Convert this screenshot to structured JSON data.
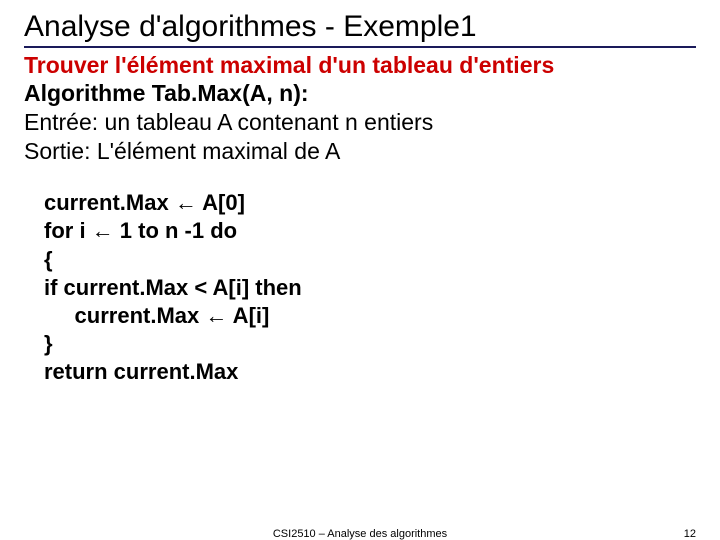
{
  "title": "Analyse d'algorithmes - Exemple1",
  "subtitle": "Trouver l'élément maximal d'un tableau d'entiers",
  "desc": {
    "algo_label": "Algorithme Tab.Max(A, n):",
    "input": "Entrée: un tableau A contenant n entiers",
    "output": "Sortie: L'élément maximal de A"
  },
  "code": {
    "l1": "current.Max ← A[0]",
    "l2": "for i ← 1 to n -1 do",
    "l3": "{",
    "l4": "if current.Max < A[i] then",
    "l5": "     current.Max ← A[i]",
    "l6": "}",
    "l7": "return current.Max"
  },
  "footer": {
    "center": "CSI2510 – Analyse des algorithmes",
    "page": "12"
  }
}
